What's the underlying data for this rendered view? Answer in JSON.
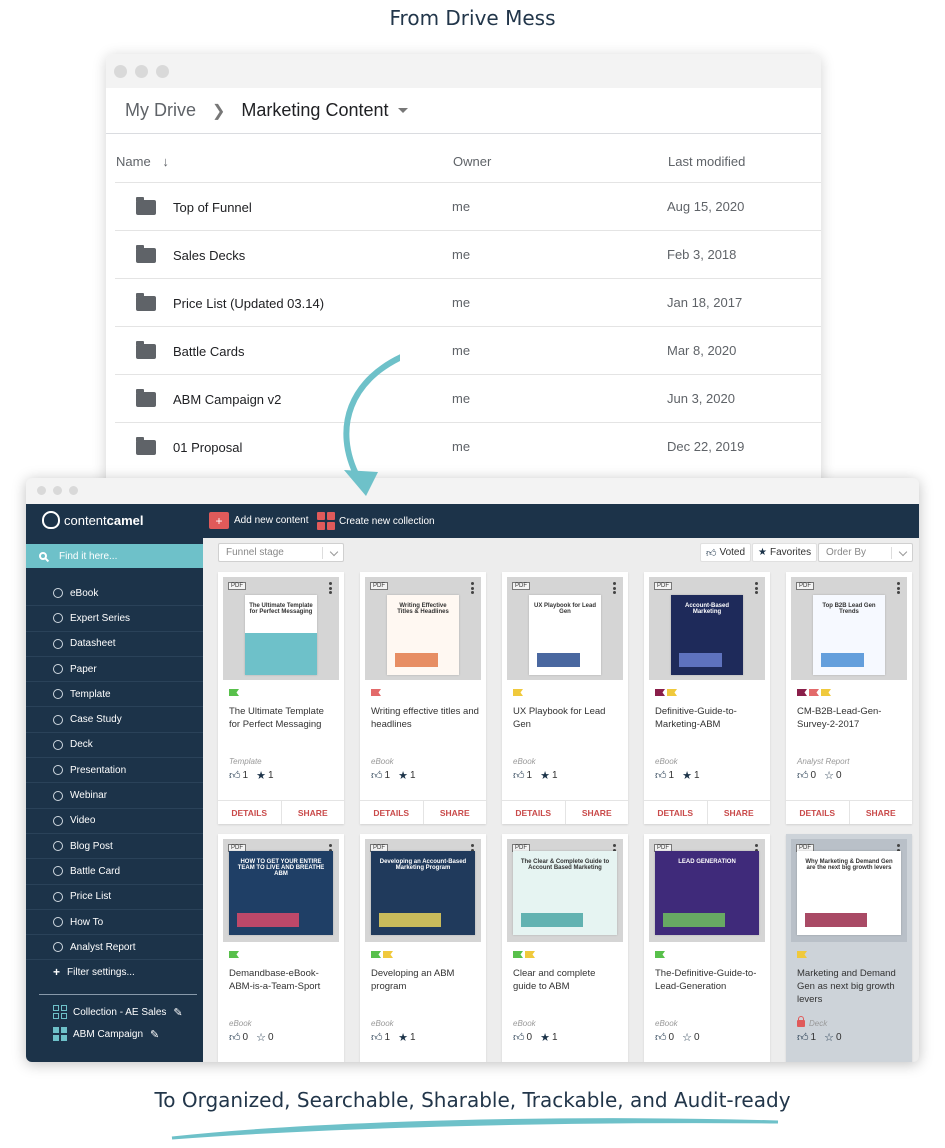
{
  "headings": {
    "top": "From Drive Mess",
    "bottom": "To Organized, Searchable, Sharable, Trackable, and Audit-ready"
  },
  "drive": {
    "breadcrumb_root": "My Drive",
    "breadcrumb_current": "Marketing Content",
    "columns": {
      "name": "Name",
      "owner": "Owner",
      "modified": "Last modified"
    },
    "rows": [
      {
        "name": "Top of Funnel",
        "owner": "me",
        "modified": "Aug 15, 2020"
      },
      {
        "name": "Sales Decks",
        "owner": "me",
        "modified": "Feb 3, 2018"
      },
      {
        "name": "Price List (Updated 03.14)",
        "owner": "me",
        "modified": "Jan 18, 2017"
      },
      {
        "name": "Battle Cards",
        "owner": "me",
        "modified": "Mar 8, 2020"
      },
      {
        "name": "ABM Campaign v2",
        "owner": "me",
        "modified": "Jun 3, 2020"
      },
      {
        "name": "01 Proposal",
        "owner": "me",
        "modified": "Dec 22, 2019"
      }
    ]
  },
  "cc": {
    "logo_light": "content",
    "logo_bold": "camel",
    "add_content": "Add new content",
    "create_collection": "Create new collection",
    "search_placeholder": "Find it here...",
    "sidebar_items": [
      "eBook",
      "Expert Series",
      "Datasheet",
      "Paper",
      "Template",
      "Case Study",
      "Deck",
      "Presentation",
      "Webinar",
      "Video",
      "Blog Post",
      "Battle Card",
      "Price List",
      "How To",
      "Analyst Report"
    ],
    "filter_settings": "Filter settings...",
    "collections": [
      "Collection - AE Sales",
      "ABM Campaign"
    ],
    "funnel_stage": "Funnel stage",
    "voted": "Voted",
    "favorites": "Favorites",
    "order_by": "Order By",
    "details_label": "DETAILS",
    "share_label": "SHARE",
    "pdf_label": "PDF",
    "cards": [
      {
        "title": "The Ultimate Template for Perfect Messaging",
        "type": "Template",
        "votes": "1",
        "favs": "1",
        "flags": [
          "#58c04b"
        ],
        "thumb_title": "The Ultimate Template for Perfect Messaging"
      },
      {
        "title": "Writing effective titles and headlines",
        "type": "eBook",
        "votes": "1",
        "favs": "1",
        "flags": [
          "#e36a6a"
        ],
        "thumb_title": "Writing Effective Titles & Headlines"
      },
      {
        "title": "UX Playbook for Lead Gen",
        "type": "eBook",
        "votes": "1",
        "favs": "1",
        "flags": [
          "#f0c93c"
        ],
        "thumb_title": "UX Playbook for Lead Gen"
      },
      {
        "title": "Definitive-Guide-to-Marketing-ABM",
        "type": "eBook",
        "votes": "1",
        "favs": "1",
        "flags": [
          "#8a1f4a",
          "#f0c93c"
        ],
        "thumb_title": "Account-Based Marketing"
      },
      {
        "title": "CM-B2B-Lead-Gen-Survey-2-2017",
        "type": "Analyst Report",
        "votes": "0",
        "favs": "0",
        "flags": [
          "#8a1f4a",
          "#e36a6a",
          "#f0c93c"
        ],
        "thumb_title": "Top B2B Lead Gen Trends"
      },
      {
        "title": "Demandbase-eBook-ABM-is-a-Team-Sport",
        "type": "eBook",
        "votes": "0",
        "favs": "0",
        "flags": [
          "#58c04b"
        ],
        "thumb_title": "HOW TO GET YOUR ENTIRE TEAM TO LIVE AND BREATHE ABM"
      },
      {
        "title": "Developing an ABM program",
        "type": "eBook",
        "votes": "1",
        "favs": "1",
        "flags": [
          "#58c04b",
          "#f0c93c"
        ],
        "thumb_title": "Developing an Account-Based Marketing Program"
      },
      {
        "title": "Clear and complete guide to ABM",
        "type": "eBook",
        "votes": "0",
        "favs": "1",
        "flags": [
          "#58c04b",
          "#f0c93c"
        ],
        "thumb_title": "The Clear & Complete Guide to Account Based Marketing"
      },
      {
        "title": "The-Definitive-Guide-to-Lead-Generation",
        "type": "eBook",
        "votes": "0",
        "favs": "0",
        "flags": [
          "#58c04b"
        ],
        "thumb_title": "LEAD GENERATION"
      },
      {
        "title": "Marketing and Demand Gen as next big growth levers",
        "type": "Deck",
        "votes": "1",
        "favs": "0",
        "flags": [
          "#f0c93c"
        ],
        "thumb_title": "Why Marketing & Demand Gen are the next big growth levers"
      }
    ]
  }
}
